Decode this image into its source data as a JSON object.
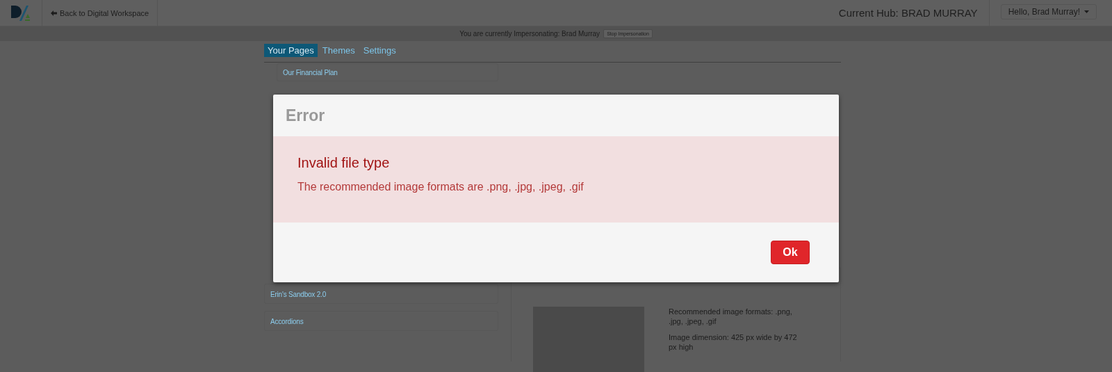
{
  "header": {
    "back_link": "Back to Digital Workspace",
    "hub": "Current Hub: BRAD MURRAY",
    "user_menu": "Hello, Brad Murray!"
  },
  "impersonation": {
    "message": "You are currently Impersonating: Brad Murray",
    "button": "Stop Impersonation"
  },
  "tabs": [
    {
      "label": "Your Pages",
      "selected": true
    },
    {
      "label": "Themes",
      "selected": false
    },
    {
      "label": "Settings",
      "selected": false
    }
  ],
  "pages": [
    {
      "title": "Our Financial Plan",
      "kind": "child"
    },
    {
      "title": "Erin's Sandbox 2.0",
      "kind": "top"
    },
    {
      "title": "Accordions",
      "kind": "top"
    }
  ],
  "banner_panel": {
    "formats_note": "Recommended image formats: .png, .jpg, .jpeg, .gif",
    "dimension_note": "Image dimension: 425 px wide by 472 px high"
  },
  "dialog": {
    "title": "Error",
    "heading": "Invalid file type",
    "message": "The recommended image formats are .png, .jpg, .jpeg, .gif",
    "button": "Ok"
  }
}
